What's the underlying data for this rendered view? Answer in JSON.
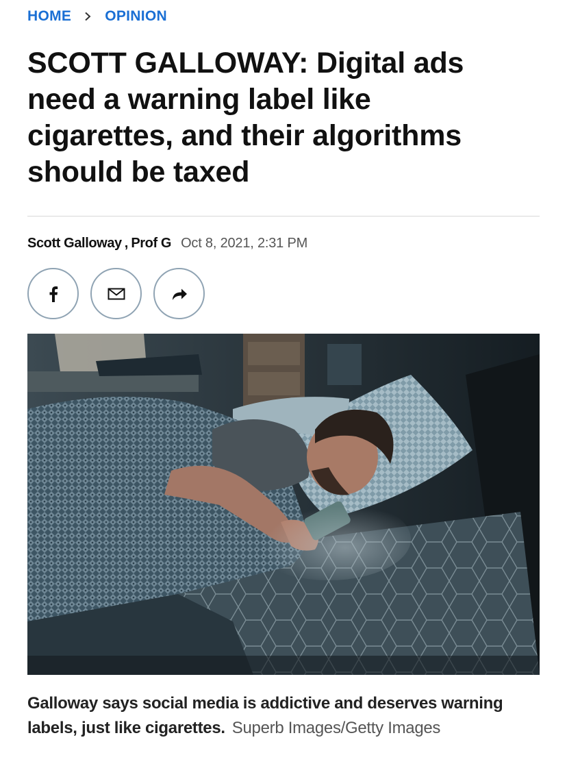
{
  "breadcrumb": {
    "home_label": "HOME",
    "section_label": "OPINION"
  },
  "article": {
    "headline": "SCOTT GALLOWAY: Digital ads need a warning label like cigarettes, and their algorithms should be taxed",
    "byline": {
      "author": "Scott Galloway",
      "separator": ",",
      "affiliation": "Prof G",
      "date": "Oct 8, 2021, 2:31 PM"
    },
    "share_buttons": [
      {
        "icon": "facebook-icon"
      },
      {
        "icon": "email-icon"
      },
      {
        "icon": "share-arrow-icon"
      }
    ],
    "image": {
      "description_icon": "photo"
    },
    "caption": {
      "text": "Galloway says social media is addictive and deserves warning labels, just like cigarettes.",
      "credit": "Superb Images/Getty Images"
    }
  },
  "colors": {
    "link_blue": "#1a6fd4",
    "text_dark": "#111111",
    "text_muted": "#555555",
    "share_border": "#8fa3b3",
    "divider": "#d7d7d7"
  }
}
